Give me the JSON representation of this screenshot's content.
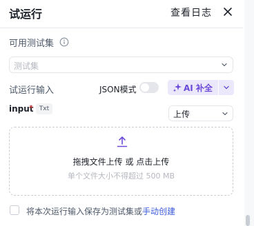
{
  "header": {
    "title": "试运行",
    "view_log_label": "查看日志",
    "close_icon": "close-icon"
  },
  "dataset": {
    "label": "可用测试集",
    "info_icon": "info-icon",
    "placeholder": "测试集"
  },
  "run_input": {
    "label": "试运行输入",
    "json_mode_label": "JSON模式",
    "json_mode_on": false,
    "ai_button_label": "AI 补全",
    "ai_icon": "sparkle-icon",
    "accent_color": "#6b4bd8"
  },
  "input_field": {
    "name": "input",
    "required_mark": "*",
    "type_tag": "Txt",
    "mode_value": "上传"
  },
  "upload": {
    "icon": "upload-icon",
    "primary_text": "拖拽文件上传 或 点击上传",
    "hint_text": "单个文件大小不得超过 500 MB"
  },
  "save": {
    "checked": false,
    "text": "将本次运行输入保存为测试集或",
    "link_text": "手动创建",
    "link_color": "#3b5bdb"
  }
}
